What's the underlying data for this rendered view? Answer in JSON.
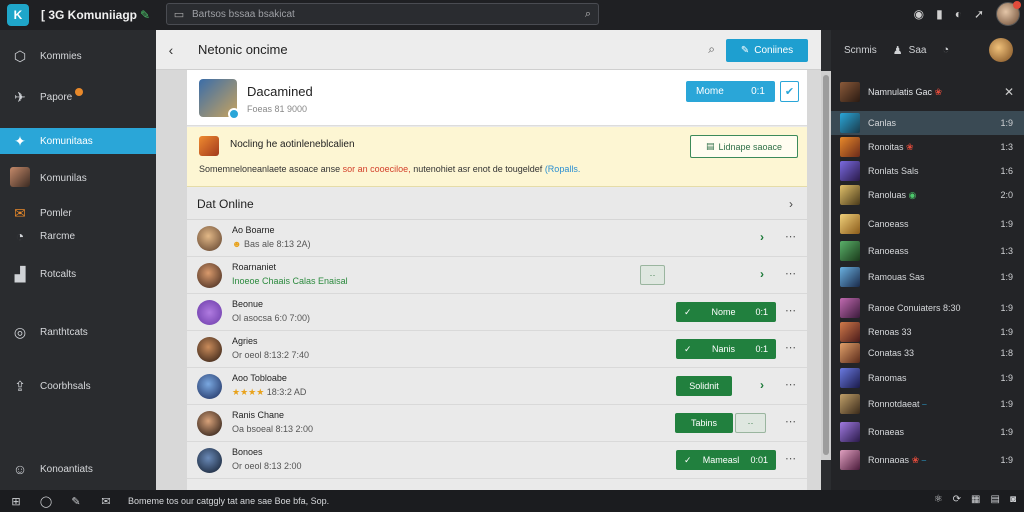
{
  "app": {
    "logo_text": "K",
    "title": "[ 3G Komuniiagp",
    "search_placeholder": "Bartsos bssaa bsakicat"
  },
  "top_icons": [
    "camera-icon",
    "bookmark-icon",
    "eye-icon",
    "share-icon"
  ],
  "leftnav": {
    "items": [
      {
        "label": "Kommies"
      },
      {
        "label": "Papore"
      },
      {
        "label": "Komunitaas"
      },
      {
        "label": "Komunilas"
      },
      {
        "label": "Pomler"
      },
      {
        "label": "Rarcme"
      },
      {
        "label": "Rotcalts"
      },
      {
        "label": "Ranthtcats"
      },
      {
        "label": "Coorbhsals"
      },
      {
        "label": "Konoantiats"
      }
    ]
  },
  "main": {
    "title": "Netonic oncime",
    "header_button": "Coniines",
    "profile": {
      "name": "Dacamined",
      "sub": "Foeas 81 9000",
      "button": "Mome",
      "button_count": "0:1"
    },
    "notice": {
      "title": "Nocling he aotinleneblcalien",
      "text_a": "Somemneloneanlaete asoace anse",
      "text_red": "sor an cooeciloe,",
      "text_b": "nutenohiet asr enot de tougeldef",
      "text_blue": "(Ropalls.",
      "button": "Lidnape saoace"
    },
    "section_title": "Dat Online",
    "rows": [
      {
        "name": "Ao Boarne",
        "meta": "Bas ale 8:13 2A)",
        "button": ""
      },
      {
        "name": "Roarnaniet",
        "meta": "Inoeoe Chaais Calas Enaisal",
        "button": ""
      },
      {
        "name": "Beonue",
        "meta": "Ol asocsa 6:0 7:00)",
        "button": "Nome",
        "count": "0:1"
      },
      {
        "name": "Agries",
        "meta": "Or oeol 8:13:2 7:40",
        "button": "Nanis",
        "count": "0:1"
      },
      {
        "name": "Aoo Tobloabe",
        "meta": "18:3:2 AD",
        "button": "Solidnit"
      },
      {
        "name": "Ranis Chane",
        "meta": "Oa bsoeal 8:13 2:00",
        "button": "Tabins"
      },
      {
        "name": "Bonoes",
        "meta": "Or oeol 8:13 2:00",
        "button": "Mameasl",
        "count": "0:01"
      }
    ]
  },
  "rightpanel": {
    "top_left": "Scnmis",
    "top_right": "Saa",
    "header": "Namnulatis Gac",
    "items": [
      {
        "label": "Canlas",
        "right": "1:9",
        "selected": true
      },
      {
        "label": "Ronoitas",
        "right": "1:3"
      },
      {
        "label": "Ronlats Sals",
        "right": "1:6"
      },
      {
        "label": "Ranoluas",
        "right": "2:0"
      },
      {
        "label": "Canoeass",
        "right": "1:9"
      },
      {
        "label": "Ranoeass",
        "right": "1:3"
      },
      {
        "label": "Ramouas Sas",
        "right": "1:9"
      },
      {
        "label": "Ranoe Conuiaters 8:30",
        "right": "1:9"
      },
      {
        "label": "Renoas 33",
        "right": "1:9"
      },
      {
        "label": "Conatas 33",
        "right": "1:8"
      },
      {
        "label": "Ranomas",
        "right": "1:9"
      },
      {
        "label": "Ronnotdaeat",
        "right": "1:9"
      },
      {
        "label": "Ronaeas",
        "right": "1:9"
      },
      {
        "label": "Ronnaoas",
        "right": "1:9"
      }
    ]
  },
  "bottombar": {
    "text": "Bomeme tos our catggly tat ane sae Boe bfa, Sop."
  }
}
